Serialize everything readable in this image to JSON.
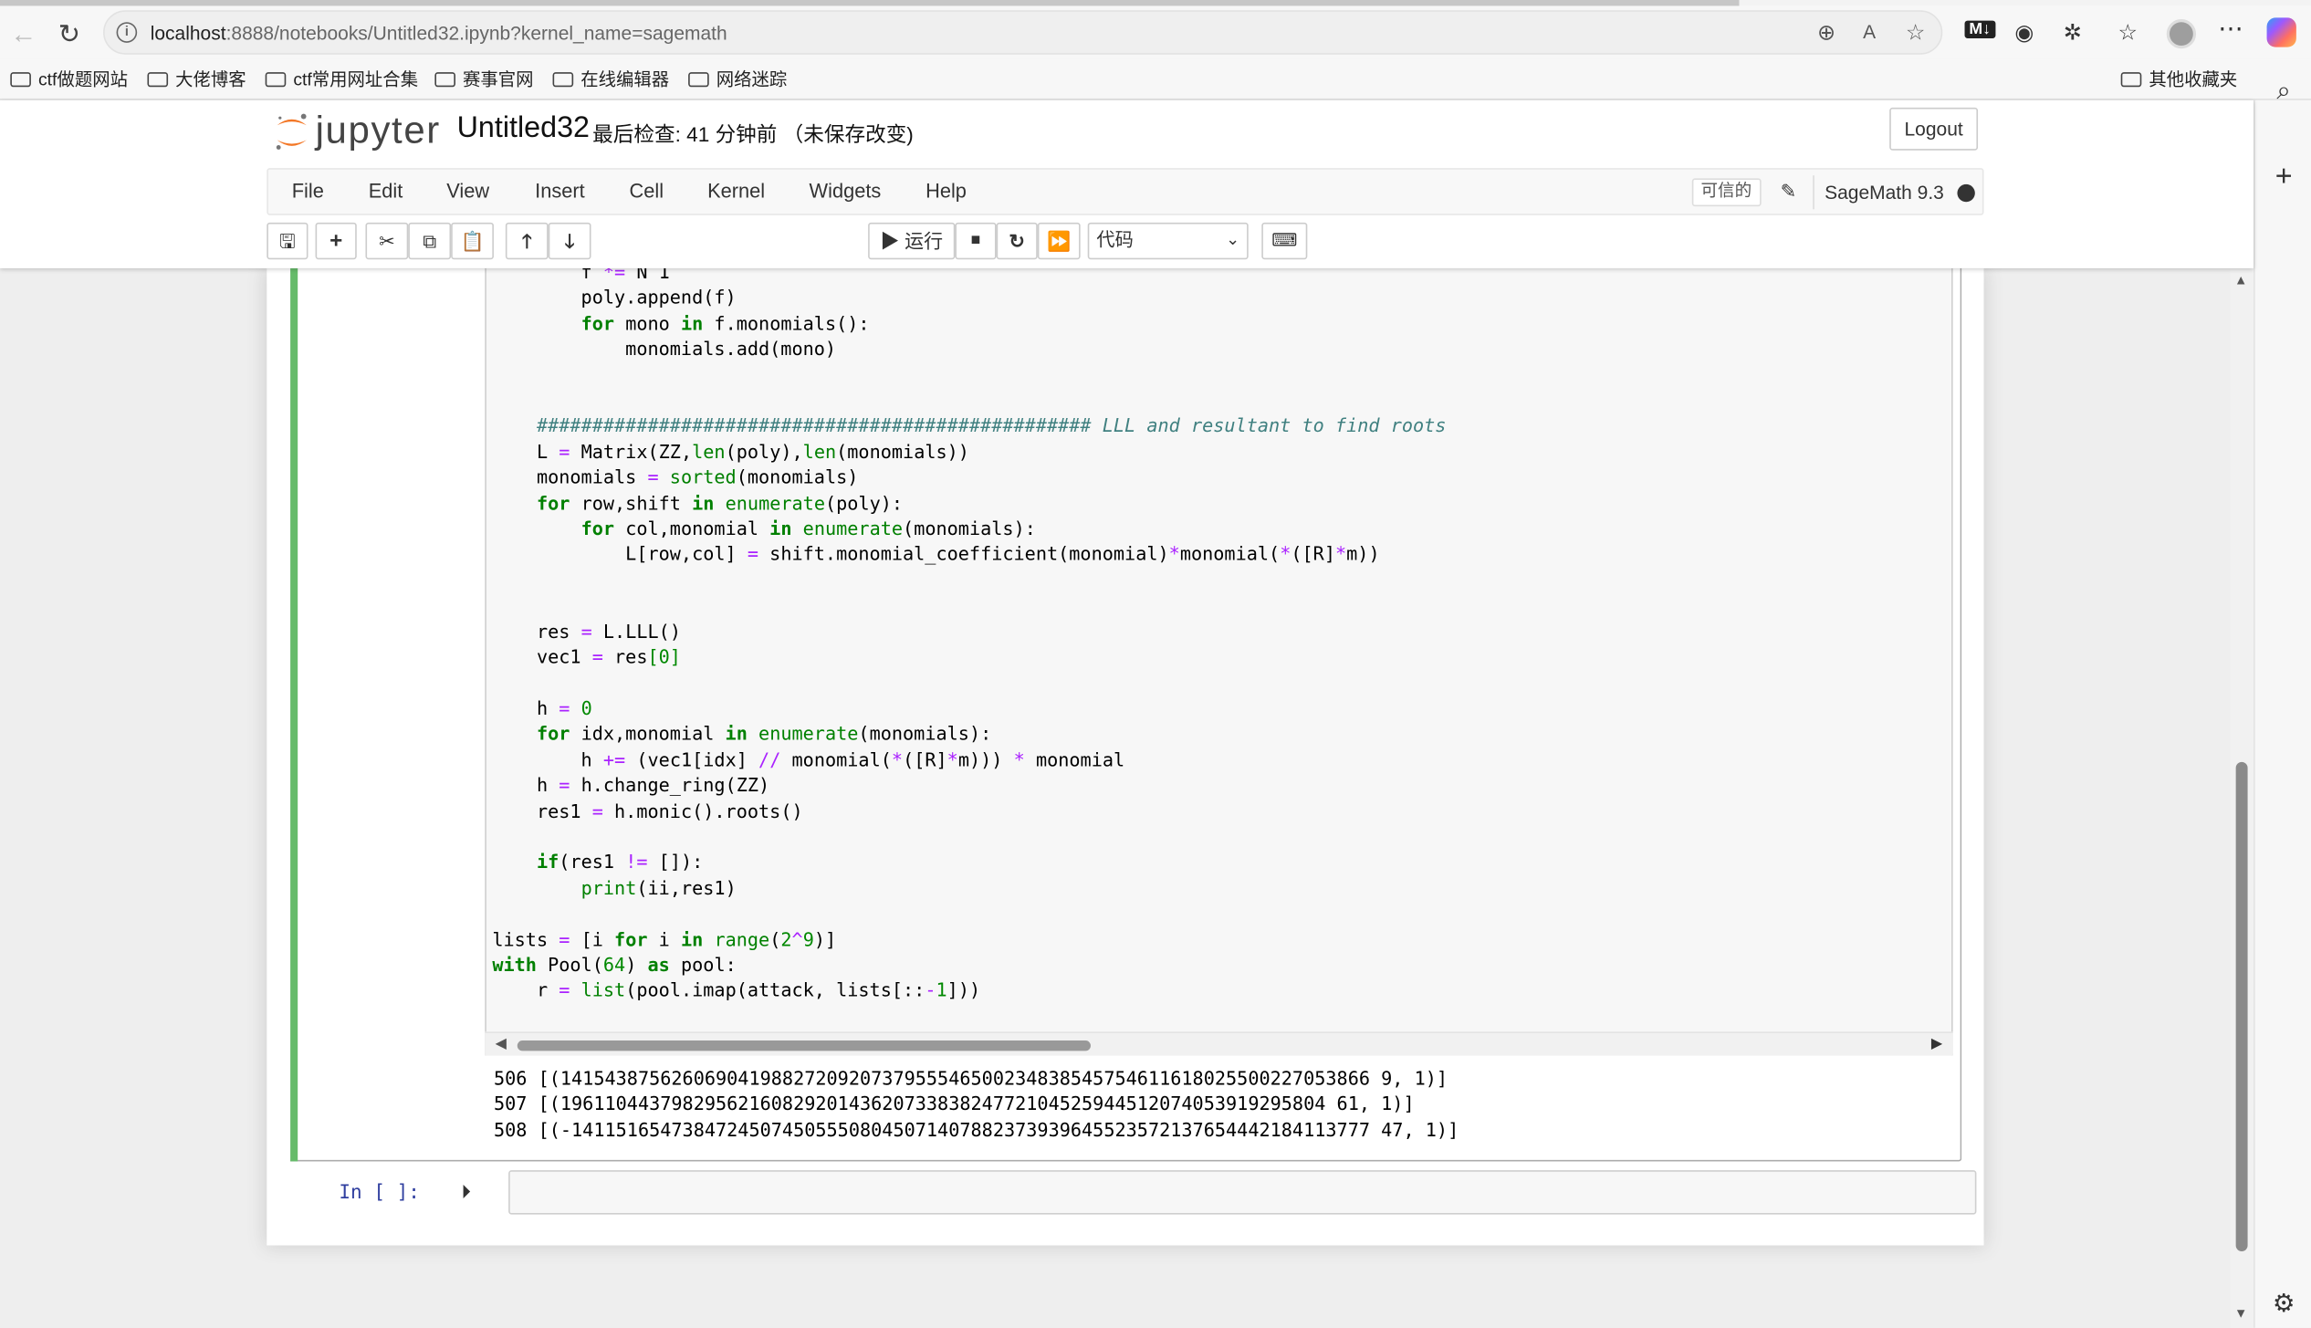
{
  "browser": {
    "url_host": "localhost",
    "url_rest": ":8888/notebooks/Untitled32.ipynb?kernel_name=sagemath",
    "bookmarks": [
      "ctf做题网站",
      "大佬博客",
      "ctf常用网址合集",
      "赛事官网",
      "在线编辑器",
      "网络迷踪"
    ],
    "other_bookmarks": "其他收藏夹"
  },
  "jupyter": {
    "logo_text": "jupyter",
    "notebook_name": "Untitled32",
    "checkpoint": "最后检查: 41 分钟前 （未保存改变)",
    "logout": "Logout",
    "menus": [
      "File",
      "Edit",
      "View",
      "Insert",
      "Cell",
      "Kernel",
      "Widgets",
      "Help"
    ],
    "trusted": "可信的",
    "kernel": "SageMath 9.3",
    "run_label": "运行",
    "cell_type": "代码"
  },
  "cells": {
    "output_lines": [
      "506 [(1415438756260690419882720920737955546500234838545754611618025500227053866 9, 1)]",
      "507 [(196110443798295621608292014362073383824772104525944512074053919295804 61, 1)]",
      "508 [(-141151654738472450745055508045071407882373939645523572137654442184113777 47, 1)]"
    ],
    "prompt": "In [ ]:"
  }
}
